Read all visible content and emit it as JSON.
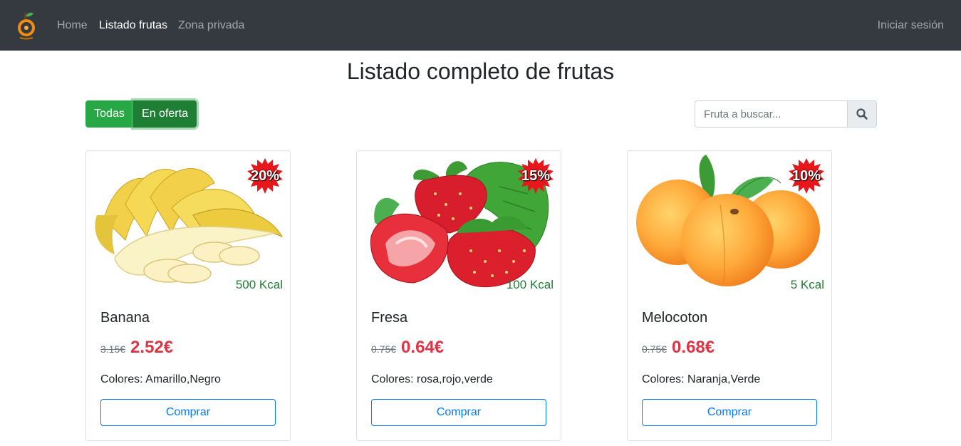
{
  "nav": {
    "logo": "orange-logo-icon",
    "home": "Home",
    "list": "Listado frutas",
    "private": "Zona privada",
    "login": "Iniciar sesión"
  },
  "page": {
    "title": "Listado completo de frutas"
  },
  "filters": {
    "all": "Todas",
    "on_sale": "En oferta",
    "active": "En oferta"
  },
  "search": {
    "placeholder": "Fruta a buscar...",
    "icon": "search-icon"
  },
  "products": [
    {
      "name": "Banana",
      "image": "banana-image",
      "discount": "20%",
      "kcal": "500 Kcal",
      "old_price": "3.15€",
      "new_price": "2.52€",
      "colors": "Colores: Amarillo,Negro",
      "buy": "Comprar"
    },
    {
      "name": "Fresa",
      "image": "strawberry-image",
      "discount": "15%",
      "kcal": "100 Kcal",
      "old_price": "0.75€",
      "new_price": "0.64€",
      "colors": "Colores: rosa,rojo,verde",
      "buy": "Comprar"
    },
    {
      "name": "Melocoton",
      "image": "peach-image",
      "discount": "10%",
      "kcal": "5 Kcal",
      "old_price": "0.75€",
      "new_price": "0.68€",
      "colors": "Colores: Naranja,Verde",
      "buy": "Comprar"
    }
  ],
  "colors": {
    "navbar": "#343a40",
    "success": "#28a745",
    "success_active": "#1e7e34",
    "danger": "#dc3545",
    "primary": "#007bff",
    "kcal": "#1e7e34"
  }
}
